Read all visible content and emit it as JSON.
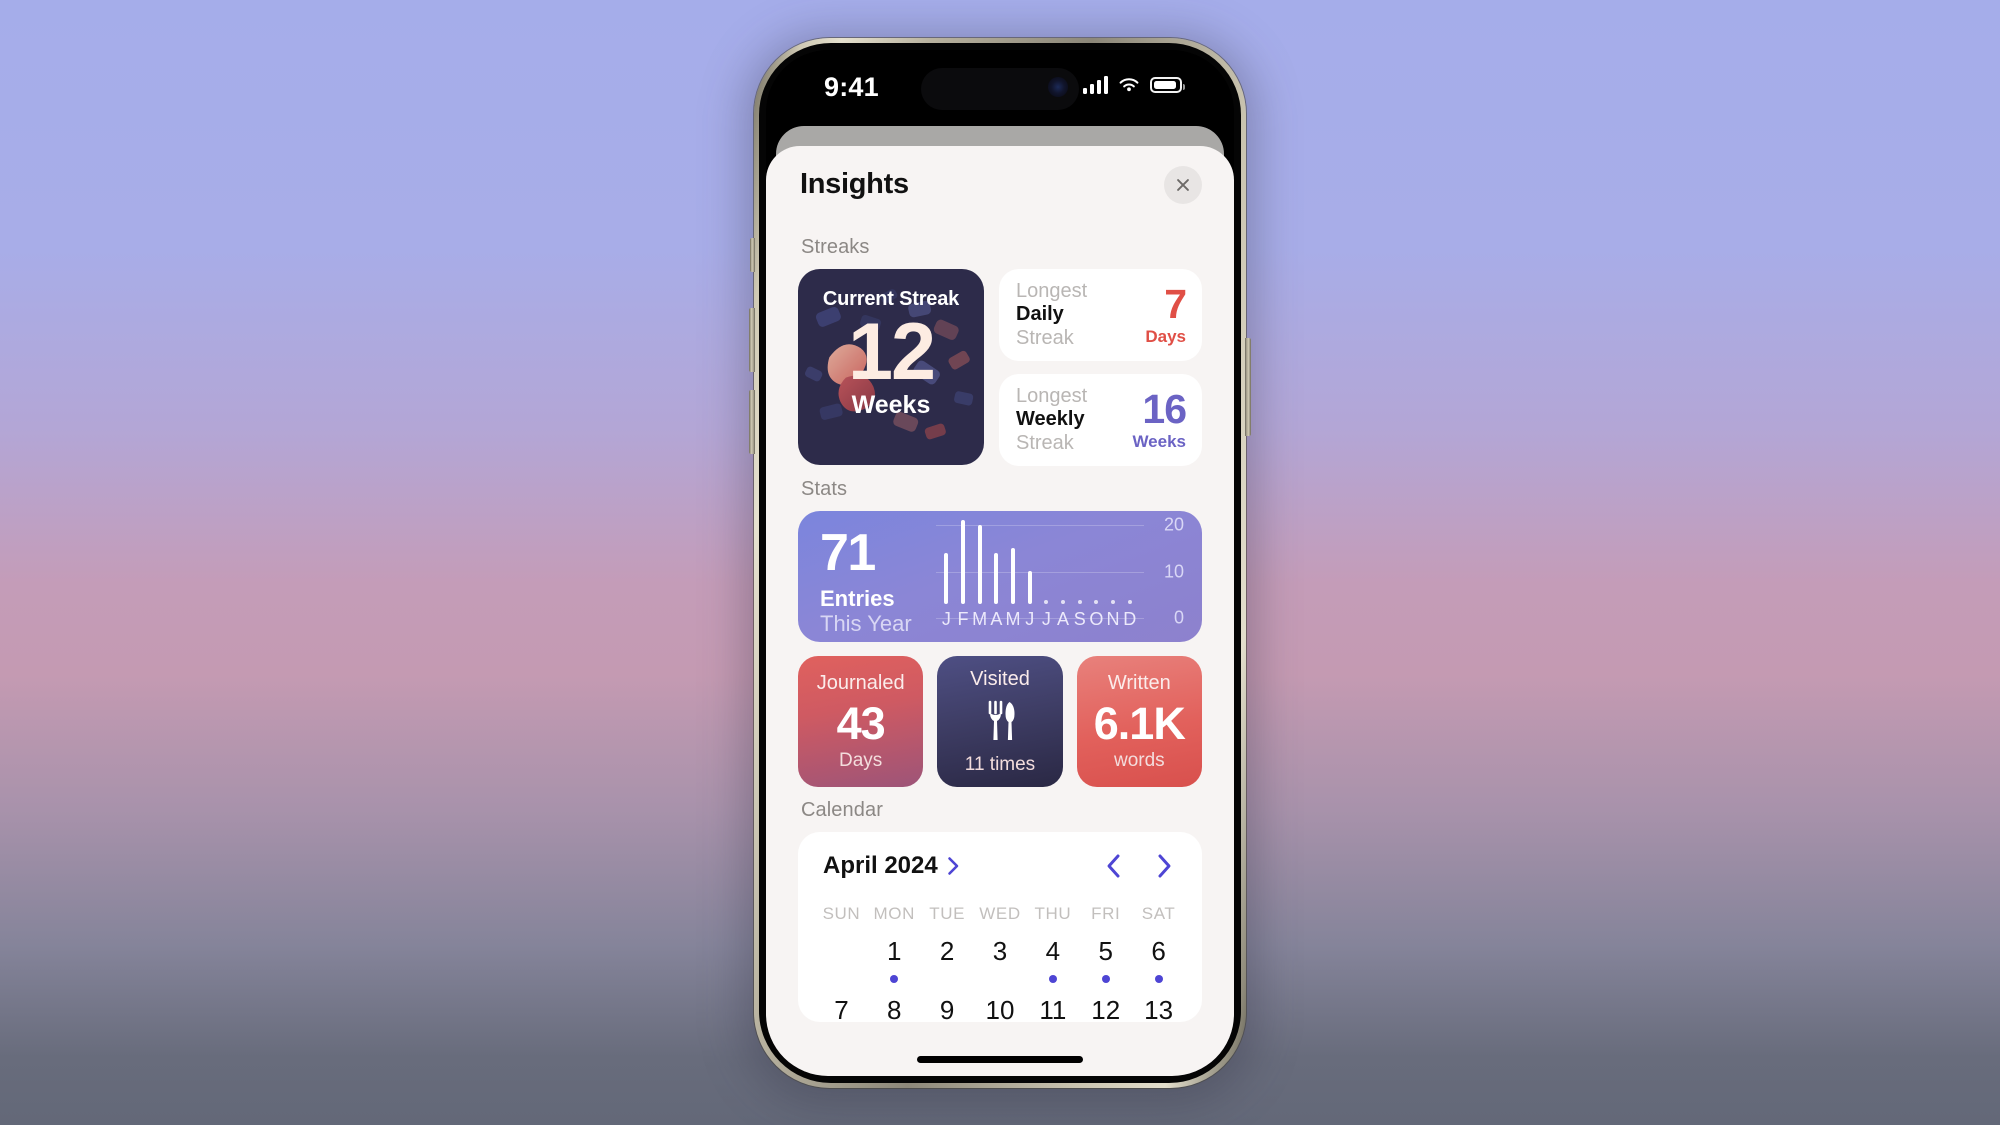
{
  "status_bar": {
    "time": "9:41",
    "icons": [
      "cellular-signal-icon",
      "wifi-icon",
      "battery-icon"
    ]
  },
  "sheet": {
    "title": "Insights",
    "close_label": "close-icon"
  },
  "sections": {
    "streaks_label": "Streaks",
    "stats_label": "Stats",
    "calendar_label": "Calendar"
  },
  "streaks": {
    "current": {
      "title": "Current Streak",
      "value": "12",
      "unit": "Weeks"
    },
    "cards": [
      {
        "line1": "Longest",
        "line2": "Daily",
        "line3": "Streak",
        "value": "7",
        "unit": "Days",
        "color": "#e04f46"
      },
      {
        "line1": "Longest",
        "line2": "Weekly",
        "line3": "Streak",
        "value": "16",
        "unit": "Weeks",
        "color": "#6b63c4"
      }
    ]
  },
  "stats": {
    "entries": {
      "value": "71",
      "line1": "Entries",
      "line2": "This Year"
    },
    "tiles": [
      {
        "top": "Journaled",
        "value": "43",
        "bottom": "Days",
        "icon": ""
      },
      {
        "top": "Visited",
        "value": "",
        "bottom": "11 times",
        "icon": "fork-knife-icon"
      },
      {
        "top": "Written",
        "value": "6.1K",
        "bottom": "words",
        "icon": ""
      }
    ]
  },
  "chart_data": {
    "type": "bar",
    "title": "Entries This Year",
    "categories": [
      "J",
      "F",
      "M",
      "A",
      "M",
      "J",
      "J",
      "A",
      "S",
      "O",
      "N",
      "D"
    ],
    "values": [
      11,
      18,
      17,
      11,
      12,
      7,
      0,
      0,
      0,
      0,
      0,
      0
    ],
    "xlabel": "",
    "ylabel": "",
    "ylim": [
      0,
      20
    ],
    "yticks": [
      20,
      10,
      0
    ],
    "ytick_labels": [
      "20",
      "10",
      "0"
    ],
    "grid": true,
    "legend": false,
    "total": 71,
    "series_color": "#ffffff",
    "background": "#8a86d8"
  },
  "calendar": {
    "month": "April 2024",
    "prev_label": "chevron-left-icon",
    "next_label": "chevron-right-icon",
    "disclosure": "chevron-right-icon",
    "weekdays": [
      "SUN",
      "MON",
      "TUE",
      "WED",
      "THU",
      "FRI",
      "SAT"
    ],
    "rows": [
      {
        "days": [
          {
            "num": "",
            "dot": false
          },
          {
            "num": "1",
            "dot": true
          },
          {
            "num": "2",
            "dot": false
          },
          {
            "num": "3",
            "dot": false
          },
          {
            "num": "4",
            "dot": true
          },
          {
            "num": "5",
            "dot": true
          },
          {
            "num": "6",
            "dot": true
          }
        ]
      },
      {
        "days": [
          {
            "num": "7",
            "dot": false
          },
          {
            "num": "8",
            "dot": false
          },
          {
            "num": "9",
            "dot": false
          },
          {
            "num": "10",
            "dot": false
          },
          {
            "num": "11",
            "dot": false
          },
          {
            "num": "12",
            "dot": false
          },
          {
            "num": "13",
            "dot": false
          }
        ]
      }
    ]
  },
  "colors": {
    "accent": "#4e45d4",
    "red": "#e04f46",
    "purple": "#6b63c4",
    "sheet_bg": "#f7f4f3"
  }
}
